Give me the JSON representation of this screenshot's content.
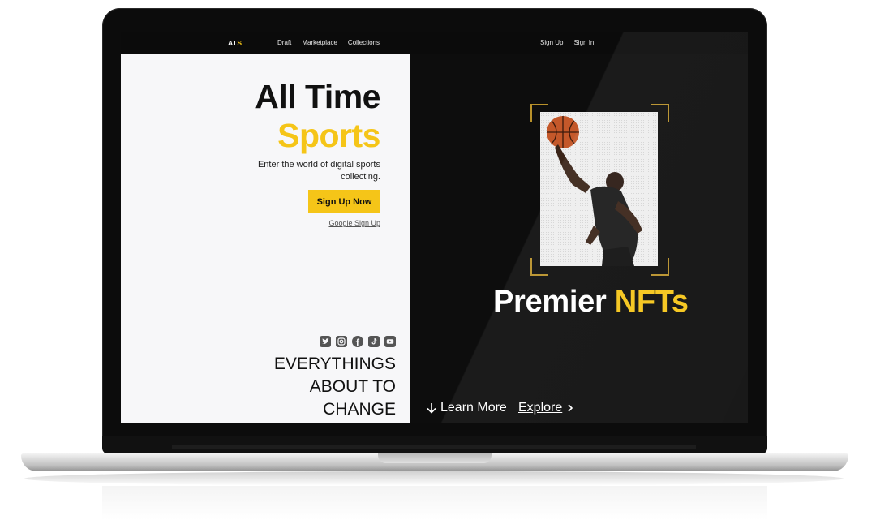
{
  "nav": {
    "logo_main": "AT",
    "logo_accent": "S",
    "links": [
      "Draft",
      "Marketplace",
      "Collections"
    ],
    "auth": [
      "Sign Up",
      "Sign In"
    ]
  },
  "hero": {
    "title_line1": "All Time",
    "title_line2": "Sports",
    "tagline": "Enter the world of digital sports collecting.",
    "cta_label": "Sign Up Now",
    "google_label": "Google Sign Up",
    "socials": [
      "twitter-icon",
      "instagram-icon",
      "facebook-icon",
      "tiktok-icon",
      "youtube-icon"
    ],
    "closing_lines": [
      "EVERYTHINGS",
      "ABOUT TO",
      "CHANGE"
    ]
  },
  "showcase": {
    "headline_main": "Premier",
    "headline_accent": "NFTs",
    "learn_more": "Learn More",
    "explore": "Explore"
  },
  "colors": {
    "accent": "#f5c518",
    "dark": "#0d0d0d",
    "light_panel": "#f7f7f9",
    "frame_gold": "#b8912a"
  }
}
